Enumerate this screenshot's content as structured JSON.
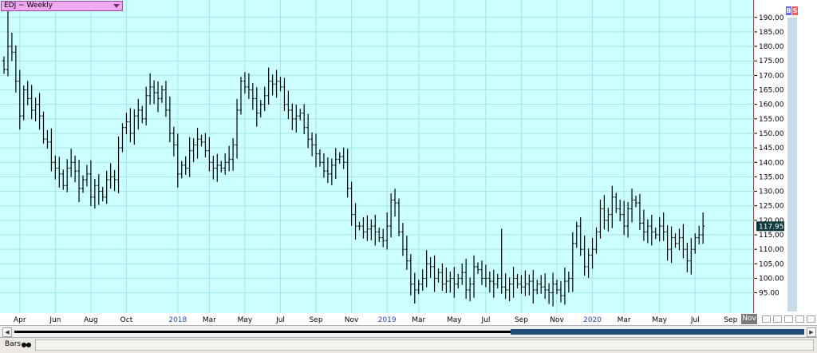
{
  "chart_title": "EDJ ~ Weekly",
  "right_buttons": [
    {
      "label": "B",
      "color": "#6666ff"
    },
    {
      "label": "S",
      "color": "#ff5555"
    }
  ],
  "status_label": "Bars",
  "colors": {
    "plot_bg": "#ccffff",
    "grid": "#a8e4e8",
    "bar": "#000000",
    "price_tag": "#0b3a3a",
    "month_text": "#000000",
    "year_text": "#2050c0"
  },
  "chart_data": {
    "type": "ohlc",
    "title": "EDJ ~ Weekly",
    "ylim": [
      88,
      196
    ],
    "y_ticks": [
      "190.00",
      "185.00",
      "180.00",
      "175.00",
      "170.00",
      "165.00",
      "160.00",
      "155.00",
      "150.00",
      "145.00",
      "140.00",
      "135.00",
      "130.00",
      "125.00",
      "120.00",
      "115.00",
      "110.00",
      "105.00",
      "100.00",
      "95.00"
    ],
    "last_price": "117.95",
    "x_ticks": [
      {
        "label": "Apr",
        "week": 4,
        "year": false
      },
      {
        "label": "Jun",
        "week": 13,
        "year": false
      },
      {
        "label": "Aug",
        "week": 22,
        "year": false
      },
      {
        "label": "Oct",
        "week": 31,
        "year": false
      },
      {
        "label": "2018",
        "week": 44,
        "year": true
      },
      {
        "label": "Mar",
        "week": 52,
        "year": false
      },
      {
        "label": "May",
        "week": 61,
        "year": false
      },
      {
        "label": "Jul",
        "week": 70,
        "year": false
      },
      {
        "label": "Sep",
        "week": 79,
        "year": false
      },
      {
        "label": "Nov",
        "week": 88,
        "year": false
      },
      {
        "label": "2019",
        "week": 97,
        "year": true
      },
      {
        "label": "Mar",
        "week": 105,
        "year": false
      },
      {
        "label": "May",
        "week": 114,
        "year": false
      },
      {
        "label": "Jul",
        "week": 122,
        "year": false
      },
      {
        "label": "Sep",
        "week": 131,
        "year": false
      },
      {
        "label": "Nov",
        "week": 140,
        "year": false
      },
      {
        "label": "2020",
        "week": 149,
        "year": true
      },
      {
        "label": "Mar",
        "week": 157,
        "year": false
      },
      {
        "label": "May",
        "week": 166,
        "year": false
      },
      {
        "label": "Jul",
        "week": 175,
        "year": false
      },
      {
        "label": "Sep",
        "week": 184,
        "year": false
      },
      {
        "label": "Nov",
        "week": 193,
        "year": false
      }
    ],
    "close": [
      172,
      180,
      178,
      168,
      156,
      165,
      162,
      158,
      160,
      156,
      148,
      147,
      140,
      138,
      136,
      132,
      138,
      140,
      137,
      131,
      134,
      136,
      128,
      132,
      130,
      128,
      134,
      135,
      134,
      145,
      152,
      154,
      150,
      156,
      158,
      155,
      163,
      166,
      164,
      162,
      165,
      158,
      150,
      146,
      136,
      139,
      138,
      144,
      146,
      148,
      147,
      144,
      140,
      138,
      139,
      138,
      140,
      141,
      146,
      158,
      168,
      166,
      165,
      162,
      157,
      160,
      163,
      168,
      167,
      168,
      166,
      160,
      158,
      155,
      156,
      157,
      152,
      148,
      146,
      143,
      140,
      137,
      136,
      139,
      141,
      142,
      140,
      131,
      122,
      118,
      118,
      116,
      117,
      118,
      116,
      114,
      113,
      118,
      127,
      126,
      116,
      110,
      106,
      98,
      96,
      98,
      100,
      105,
      104,
      100,
      102,
      98,
      99,
      100,
      98,
      100,
      102,
      96,
      98,
      104,
      103,
      100,
      100,
      99,
      98,
      100,
      97,
      96,
      98,
      100,
      98,
      97,
      98,
      99,
      96,
      98,
      97,
      96,
      95,
      98,
      96,
      94,
      99,
      100,
      112,
      118,
      110,
      104,
      108,
      110,
      116,
      124,
      120,
      122,
      128,
      124,
      122,
      118,
      124,
      127,
      126,
      119,
      116,
      118,
      116,
      115,
      118,
      116,
      110,
      114,
      112,
      114,
      110,
      106,
      110,
      114,
      115,
      118
    ]
  }
}
